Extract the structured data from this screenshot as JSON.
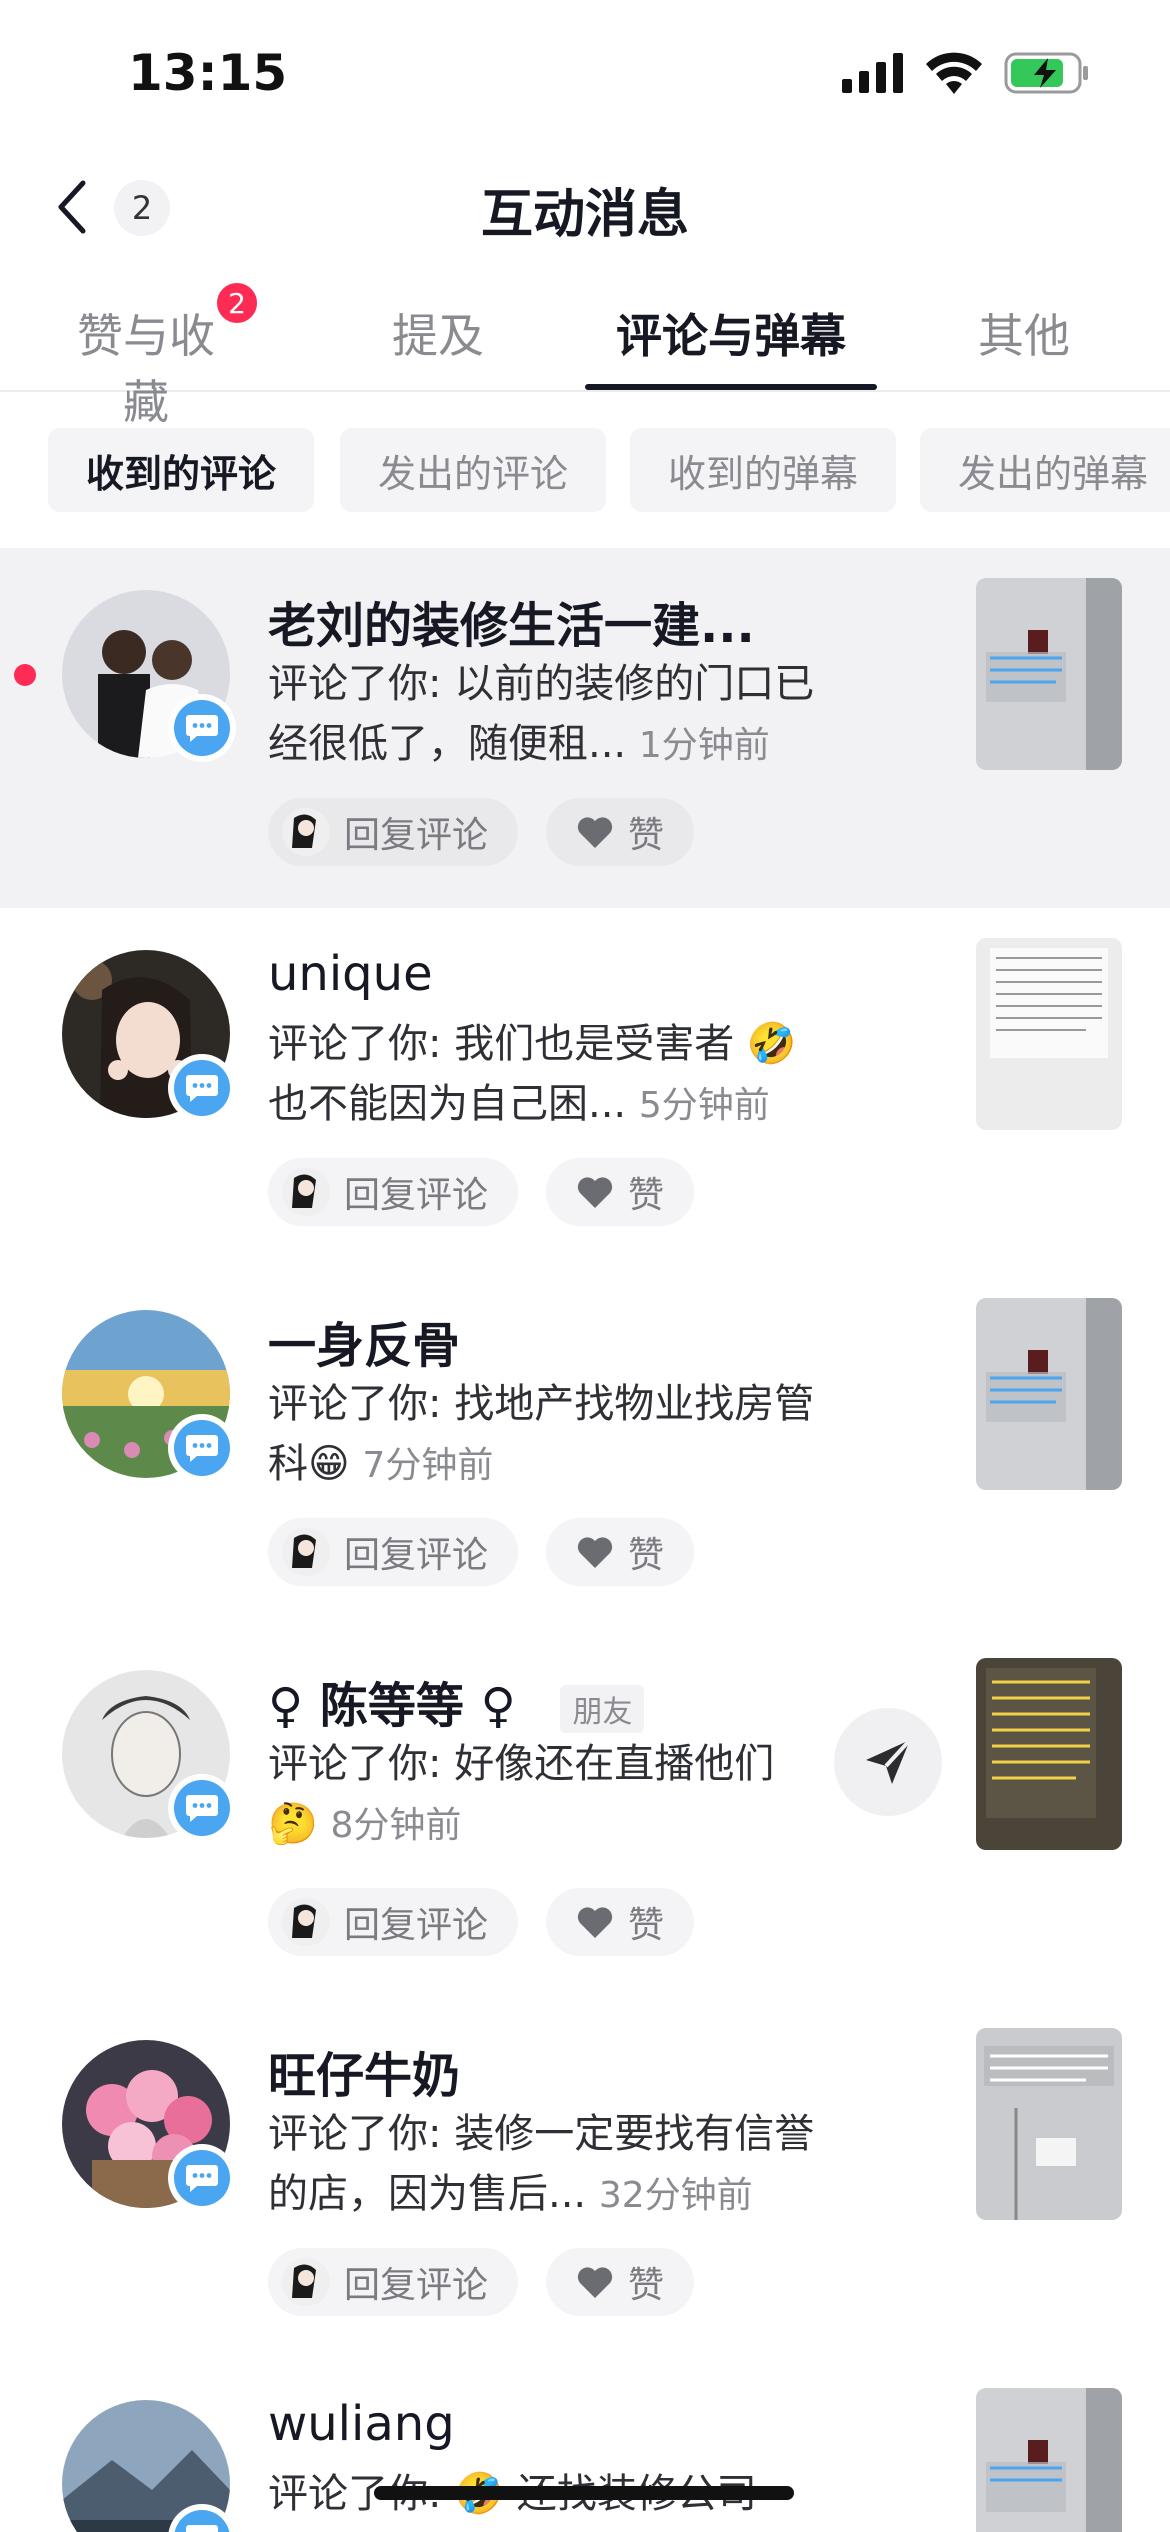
{
  "status": {
    "time": "13:15"
  },
  "nav": {
    "back_count": "2",
    "title": "互动消息"
  },
  "tabs": [
    {
      "label": "赞与收藏",
      "badge": "2"
    },
    {
      "label": "提及"
    },
    {
      "label": "评论与弹幕"
    },
    {
      "label": "其他"
    }
  ],
  "filters": [
    "收到的评论",
    "发出的评论",
    "收到的弹幕",
    "发出的弹幕"
  ],
  "actions": {
    "reply_label": "回复评论",
    "like_label": "赞"
  },
  "items": [
    {
      "name": "老刘的装修生活一建...",
      "comment": "评论了你: 以前的装修的门口已经很低了，随便租...",
      "time": "1分钟前"
    },
    {
      "name": "unique",
      "comment": "评论了你: 我们也是受害者 🤣 也不能因为自己困...",
      "time": "5分钟前"
    },
    {
      "name": "一身反骨",
      "comment": "评论了你: 找地产找物业找房管科😁",
      "time": "7分钟前"
    },
    {
      "name": "♀ 陈等等 ♀",
      "friend_tag": "朋友",
      "comment": "评论了你: 好像还在直播他们 🤔",
      "time": "8分钟前"
    },
    {
      "name": "旺仔牛奶",
      "comment": "评论了你: 装修一定要找有信誉的店，因为售后...",
      "time": "32分钟前"
    },
    {
      "name": "wuliang",
      "comment": "评论了你: 🤣 还找装修公司",
      "time": ""
    }
  ]
}
